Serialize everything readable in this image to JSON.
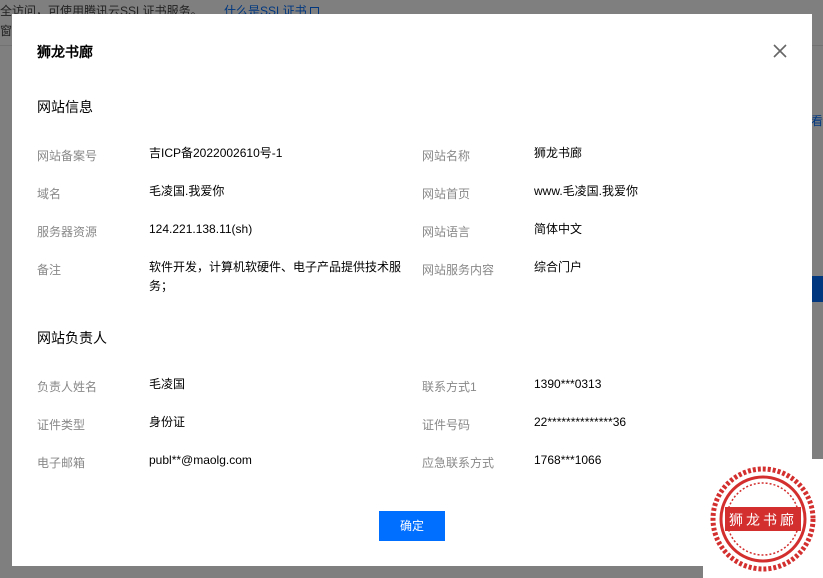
{
  "background": {
    "top_text_prefix": "全访问，可使用腾讯云SSL证书服务。",
    "top_link": "什么是SSL证书",
    "row2_text": "窗口"
  },
  "modal": {
    "title": "狮龙书廊",
    "close_icon": "close-icon",
    "sections": {
      "site_info": {
        "title": "网站信息",
        "fields": {
          "record_no_label": "网站备案号",
          "record_no": "吉ICP备2022002610号-1",
          "site_name_label": "网站名称",
          "site_name": "狮龙书廊",
          "domain_label": "域名",
          "domain": "毛凌国.我爱你",
          "homepage_label": "网站首页",
          "homepage": "www.毛凌国.我爱你",
          "server_label": "服务器资源",
          "server": "124.221.138.11(sh)",
          "language_label": "网站语言",
          "language": "简体中文",
          "remark_label": "备注",
          "remark": "软件开发，计算机软硬件、电子产品提供技术服务；",
          "content_label": "网站服务内容",
          "content": "综合门户"
        }
      },
      "owner": {
        "title": "网站负责人",
        "fields": {
          "name_label": "负责人姓名",
          "name": "毛凌国",
          "contact_label": "联系方式1",
          "contact": "1390***0313",
          "id_type_label": "证件类型",
          "id_type": "身份证",
          "id_no_label": "证件号码",
          "id_no": "22**************36",
          "email_label": "电子邮箱",
          "email": "publ**@maolg.com",
          "emergency_label": "应急联系方式",
          "emergency": "1768***1066"
        }
      }
    },
    "ok_label": "确定"
  },
  "seal": {
    "text": "狮龙书廊",
    "color": "#d32f2f"
  },
  "colors": {
    "accent": "#006eff",
    "label": "#888888"
  }
}
